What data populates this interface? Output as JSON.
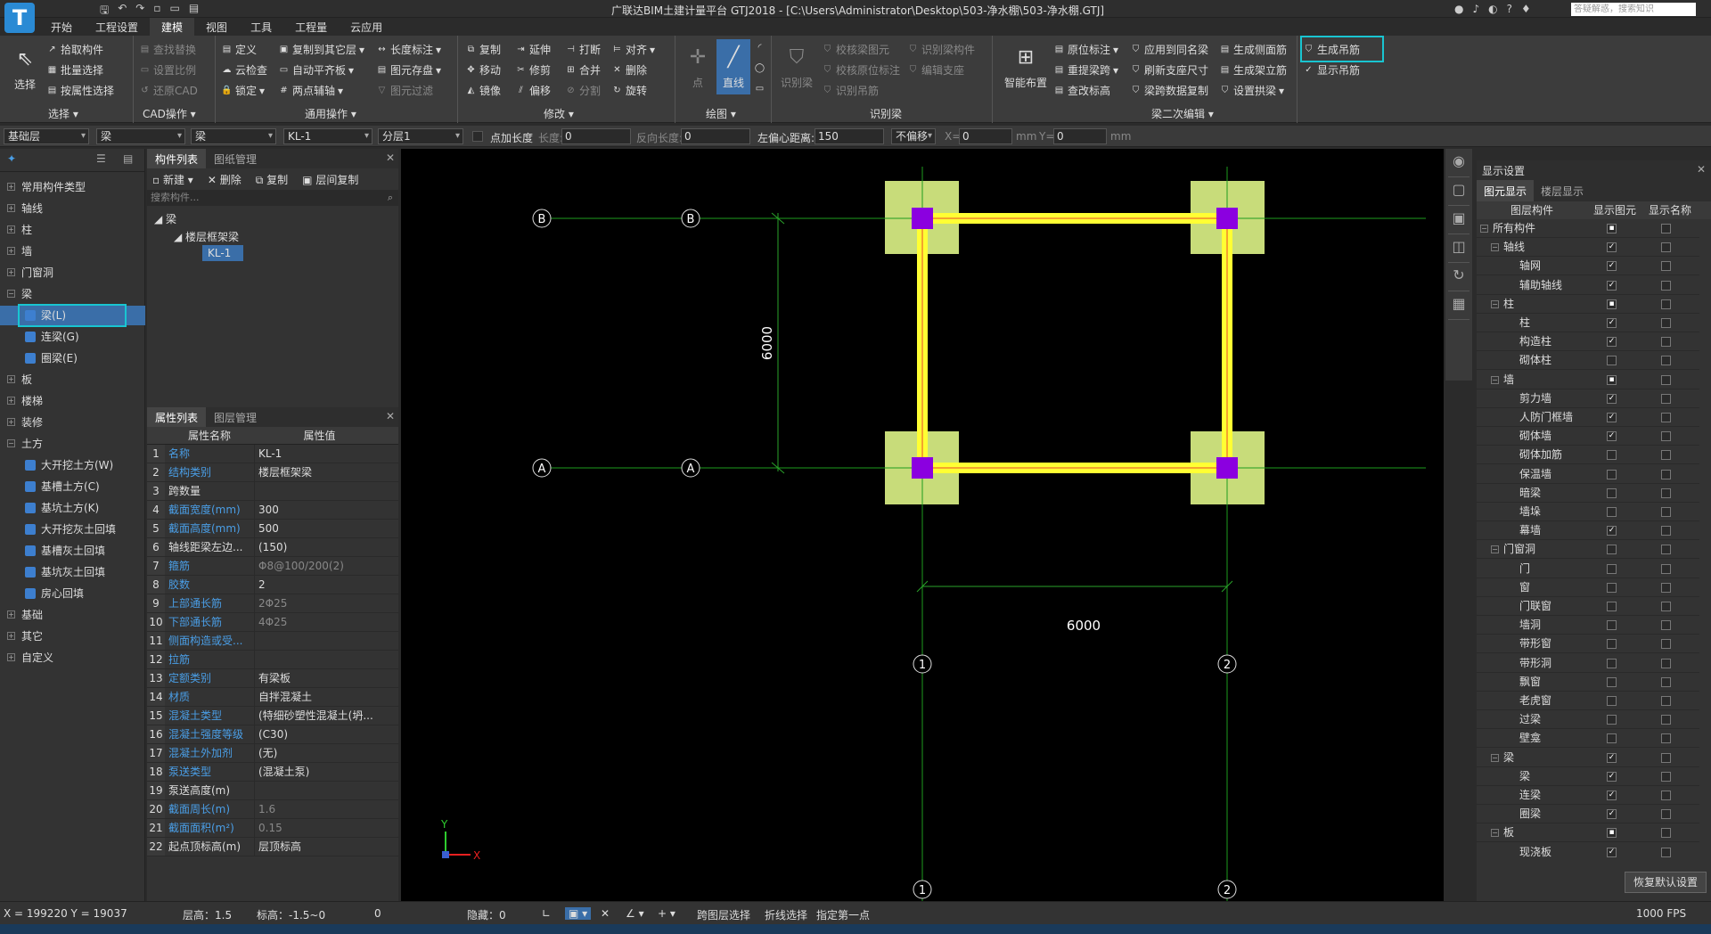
{
  "app": {
    "logo": "T",
    "title": "广联达BIM土建计量平台 GTJ2018 - [C:\\Users\\Administrator\\Desktop\\503-净水棚\\503-净水棚.GTJ]",
    "search_placeholder": "答疑解惑，搜索知识",
    "window_controls": [
      "—",
      "❐",
      "✕"
    ]
  },
  "menu": [
    "开始",
    "工程设置",
    "建模",
    "视图",
    "工具",
    "工程量",
    "云应用"
  ],
  "menu_active": "建模",
  "ribbon": {
    "select_big": "选择",
    "select": [
      "拾取构件",
      "批量选择",
      "按属性选择"
    ],
    "select_label": "选择",
    "cad": [
      "查找替换",
      "设置比例",
      "还原CAD"
    ],
    "cad_label": "CAD操作",
    "common1": [
      "定义",
      "云检查",
      "锁定"
    ],
    "common2": [
      "复制到其它层",
      "自动平齐板",
      "两点辅轴"
    ],
    "common3": [
      "长度标注",
      "图元存盘",
      "图元过滤"
    ],
    "common_label": "通用操作",
    "modify1": [
      "复制",
      "移动",
      "镜像"
    ],
    "modify2": [
      "延伸",
      "修剪",
      "偏移"
    ],
    "modify3": [
      "打断",
      "合并",
      "分割"
    ],
    "modify4": [
      "对齐",
      "删除",
      "旋转"
    ],
    "modify_label": "修改",
    "draw_point": "点",
    "draw_line": "直线",
    "draw_label": "绘图",
    "identify_big": "识别梁",
    "identify1": [
      "校核梁图元",
      "校核原位标注",
      "识别吊筋"
    ],
    "identify2": [
      "识别梁构件",
      "编辑支座"
    ],
    "identify_label": "识别梁",
    "smart_layout": "智能布置",
    "beam2_1": [
      "原位标注",
      "重提梁跨",
      "查改标高"
    ],
    "beam2_2": [
      "应用到同名梁",
      "刷新支座尺寸",
      "梁跨数据复制"
    ],
    "beam2_3": [
      "生成侧面筋",
      "生成架立筋",
      "设置拱梁"
    ],
    "beam2_label": "梁二次编辑",
    "gen_hanger": "生成吊筋",
    "show_hanger": "显示吊筋"
  },
  "propbar": {
    "floor": "基础层",
    "type": "梁",
    "subtype": "梁",
    "component": "KL-1",
    "layer": "分层1",
    "point_length": "点加长度",
    "length_label": "长度:",
    "length_value": "0",
    "rev_label": "反向长度:",
    "rev_value": "0",
    "offset_label": "左偏心距离:",
    "offset_value": "150",
    "no_offset": "不偏移",
    "x_label": "X=",
    "x_value": "0",
    "mm1": "mm",
    "y_label": "Y=",
    "y_value": "0",
    "mm2": "mm"
  },
  "nav": {
    "items": [
      {
        "label": "常用构件类型",
        "type": "group",
        "expanded": false
      },
      {
        "label": "轴线",
        "type": "group",
        "expanded": false
      },
      {
        "label": "柱",
        "type": "group",
        "expanded": false
      },
      {
        "label": "墙",
        "type": "group",
        "expanded": false
      },
      {
        "label": "门窗洞",
        "type": "group",
        "expanded": false
      },
      {
        "label": "梁",
        "type": "group",
        "expanded": true
      },
      {
        "label": "梁(L)",
        "type": "sub",
        "selected": true
      },
      {
        "label": "连梁(G)",
        "type": "sub"
      },
      {
        "label": "圈梁(E)",
        "type": "sub"
      },
      {
        "label": "板",
        "type": "group",
        "expanded": false
      },
      {
        "label": "楼梯",
        "type": "group",
        "expanded": false
      },
      {
        "label": "装修",
        "type": "group",
        "expanded": false
      },
      {
        "label": "土方",
        "type": "group",
        "expanded": true
      },
      {
        "label": "大开挖土方(W)",
        "type": "sub"
      },
      {
        "label": "基槽土方(C)",
        "type": "sub"
      },
      {
        "label": "基坑土方(K)",
        "type": "sub"
      },
      {
        "label": "大开挖灰土回填",
        "type": "sub"
      },
      {
        "label": "基槽灰土回填",
        "type": "sub"
      },
      {
        "label": "基坑灰土回填",
        "type": "sub"
      },
      {
        "label": "房心回填",
        "type": "sub"
      },
      {
        "label": "基础",
        "type": "group",
        "expanded": false
      },
      {
        "label": "其它",
        "type": "group",
        "expanded": false
      },
      {
        "label": "自定义",
        "type": "group",
        "expanded": false
      }
    ]
  },
  "component_panel": {
    "tabs": [
      "构件列表",
      "图纸管理"
    ],
    "tools": [
      "新建",
      "删除",
      "复制",
      "层间复制"
    ],
    "search_placeholder": "搜索构件...",
    "tree": [
      "梁",
      "楼层框架梁",
      "KL-1"
    ]
  },
  "property_panel": {
    "tabs": [
      "属性列表",
      "图层管理"
    ],
    "headers": [
      "属性名称",
      "属性值"
    ],
    "rows": [
      {
        "n": "1",
        "k": "名称",
        "v": "KL-1",
        "blue": true
      },
      {
        "n": "2",
        "k": "结构类别",
        "v": "楼层框架梁",
        "blue": true
      },
      {
        "n": "3",
        "k": "跨数量",
        "v": "",
        "blue": false
      },
      {
        "n": "4",
        "k": "截面宽度(mm)",
        "v": "300",
        "blue": true
      },
      {
        "n": "5",
        "k": "截面高度(mm)",
        "v": "500",
        "blue": true
      },
      {
        "n": "6",
        "k": "轴线距梁左边...",
        "v": "(150)",
        "blue": false
      },
      {
        "n": "7",
        "k": "箍筋",
        "v": "Φ8@100/200(2)",
        "blue": true,
        "dim": true
      },
      {
        "n": "8",
        "k": "胶数",
        "v": "2",
        "blue": true
      },
      {
        "n": "9",
        "k": "上部通长筋",
        "v": "2Φ25",
        "blue": true,
        "dim": true
      },
      {
        "n": "10",
        "k": "下部通长筋",
        "v": "4Φ25",
        "blue": true,
        "dim": true
      },
      {
        "n": "11",
        "k": "侧面构造或受...",
        "v": "",
        "blue": true
      },
      {
        "n": "12",
        "k": "拉筋",
        "v": "",
        "blue": true
      },
      {
        "n": "13",
        "k": "定额类别",
        "v": "有梁板",
        "blue": true
      },
      {
        "n": "14",
        "k": "材质",
        "v": "自拌混凝土",
        "blue": true
      },
      {
        "n": "15",
        "k": "混凝土类型",
        "v": "(特细砂塑性混凝土(坍...",
        "blue": true
      },
      {
        "n": "16",
        "k": "混凝土强度等级",
        "v": "(C30)",
        "blue": true
      },
      {
        "n": "17",
        "k": "混凝土外加剂",
        "v": "(无)",
        "blue": true
      },
      {
        "n": "18",
        "k": "泵送类型",
        "v": "(混凝土泵)",
        "blue": true
      },
      {
        "n": "19",
        "k": "泵送高度(m)",
        "v": "",
        "blue": false
      },
      {
        "n": "20",
        "k": "截面周长(m)",
        "v": "1.6",
        "blue": true,
        "dim": true
      },
      {
        "n": "21",
        "k": "截面面积(m²)",
        "v": "0.15",
        "blue": true,
        "dim": true
      },
      {
        "n": "22",
        "k": "起点顶标高(m)",
        "v": "层顶标高",
        "blue": false
      }
    ]
  },
  "drawing": {
    "axis_labels": [
      "B",
      "B",
      "A",
      "A",
      "1",
      "2",
      "1",
      "2"
    ],
    "dim_vertical": "6000",
    "dim_horizontal": "6000",
    "ucs_x": "X",
    "ucs_y": "Y",
    "colors": {
      "beam": "#ffff33",
      "column": "#8b00e0",
      "footing": "#c8dc7a",
      "axis": "#1e9c1e",
      "dim": "#2aa32a"
    }
  },
  "right_panel": {
    "title": "显示设置",
    "tabs": [
      "图元显示",
      "楼层显示"
    ],
    "headers": [
      "图层构件",
      "显示图元",
      "显示名称"
    ],
    "rows": [
      {
        "label": "所有构件",
        "level": 0,
        "exp": true,
        "s": "partial",
        "n": false
      },
      {
        "label": "轴线",
        "level": 1,
        "exp": true,
        "s": true,
        "n": false
      },
      {
        "label": "轴网",
        "level": 2,
        "s": true,
        "n": false
      },
      {
        "label": "辅助轴线",
        "level": 2,
        "s": true,
        "n": false
      },
      {
        "label": "柱",
        "level": 1,
        "exp": true,
        "s": "partial",
        "n": false
      },
      {
        "label": "柱",
        "level": 2,
        "s": true,
        "n": false
      },
      {
        "label": "构造柱",
        "level": 2,
        "s": true,
        "n": false
      },
      {
        "label": "砌体柱",
        "level": 2,
        "s": false,
        "n": false
      },
      {
        "label": "墙",
        "level": 1,
        "exp": true,
        "s": "partial",
        "n": false
      },
      {
        "label": "剪力墙",
        "level": 2,
        "s": true,
        "n": false
      },
      {
        "label": "人防门框墙",
        "level": 2,
        "s": true,
        "n": false
      },
      {
        "label": "砌体墙",
        "level": 2,
        "s": true,
        "n": false
      },
      {
        "label": "砌体加筋",
        "level": 2,
        "s": false,
        "n": false
      },
      {
        "label": "保温墙",
        "level": 2,
        "s": false,
        "n": false
      },
      {
        "label": "暗梁",
        "level": 2,
        "s": false,
        "n": false
      },
      {
        "label": "墙垛",
        "level": 2,
        "s": false,
        "n": false
      },
      {
        "label": "幕墙",
        "level": 2,
        "s": true,
        "n": false
      },
      {
        "label": "门窗洞",
        "level": 1,
        "exp": true,
        "s": false,
        "n": false
      },
      {
        "label": "门",
        "level": 2,
        "s": false,
        "n": false
      },
      {
        "label": "窗",
        "level": 2,
        "s": false,
        "n": false
      },
      {
        "label": "门联窗",
        "level": 2,
        "s": false,
        "n": false
      },
      {
        "label": "墙洞",
        "level": 2,
        "s": false,
        "n": false
      },
      {
        "label": "带形窗",
        "level": 2,
        "s": false,
        "n": false
      },
      {
        "label": "带形洞",
        "level": 2,
        "s": false,
        "n": false
      },
      {
        "label": "飘窗",
        "level": 2,
        "s": false,
        "n": false
      },
      {
        "label": "老虎窗",
        "level": 2,
        "s": false,
        "n": false
      },
      {
        "label": "过梁",
        "level": 2,
        "s": false,
        "n": false
      },
      {
        "label": "壁龛",
        "level": 2,
        "s": false,
        "n": false
      },
      {
        "label": "梁",
        "level": 1,
        "exp": true,
        "s": true,
        "n": false
      },
      {
        "label": "梁",
        "level": 2,
        "s": true,
        "n": false
      },
      {
        "label": "连梁",
        "level": 2,
        "s": true,
        "n": false
      },
      {
        "label": "圈梁",
        "level": 2,
        "s": true,
        "n": false
      },
      {
        "label": "板",
        "level": 1,
        "exp": true,
        "s": "partial",
        "n": false
      },
      {
        "label": "现浇板",
        "level": 2,
        "s": true,
        "n": false
      }
    ],
    "reset": "恢复默认设置"
  },
  "status": {
    "coords": "X = 199220 Y = 19037",
    "floor_height": "层高：1.5",
    "elevation": "标高：-1.5~0",
    "zero": "0",
    "hidden": "隐藏：0",
    "cross_layer": "跨图层选择",
    "polyline_select": "折线选择",
    "prompt": "指定第一点",
    "fps": "1000 FPS"
  }
}
